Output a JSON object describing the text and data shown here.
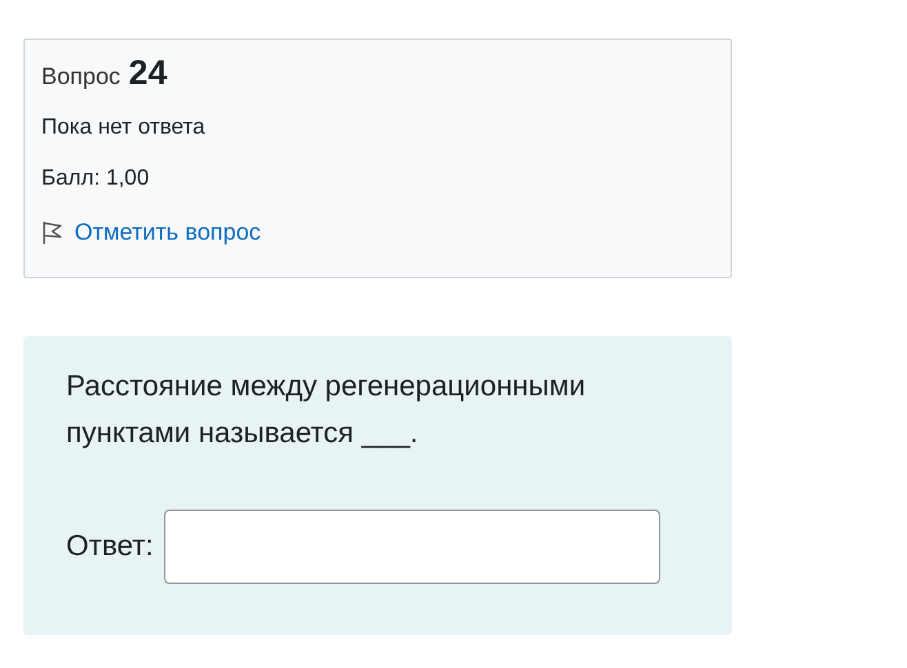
{
  "info": {
    "heading": "Вопрос",
    "number": "24",
    "state": "Пока нет ответа",
    "grade": "Балл: 1,00",
    "flag": {
      "label": "Отметить вопрос",
      "flagged": false
    }
  },
  "question": {
    "text": "Расстояние между регенерационными пунктами называется ___.",
    "answer_label": "Ответ:"
  }
}
